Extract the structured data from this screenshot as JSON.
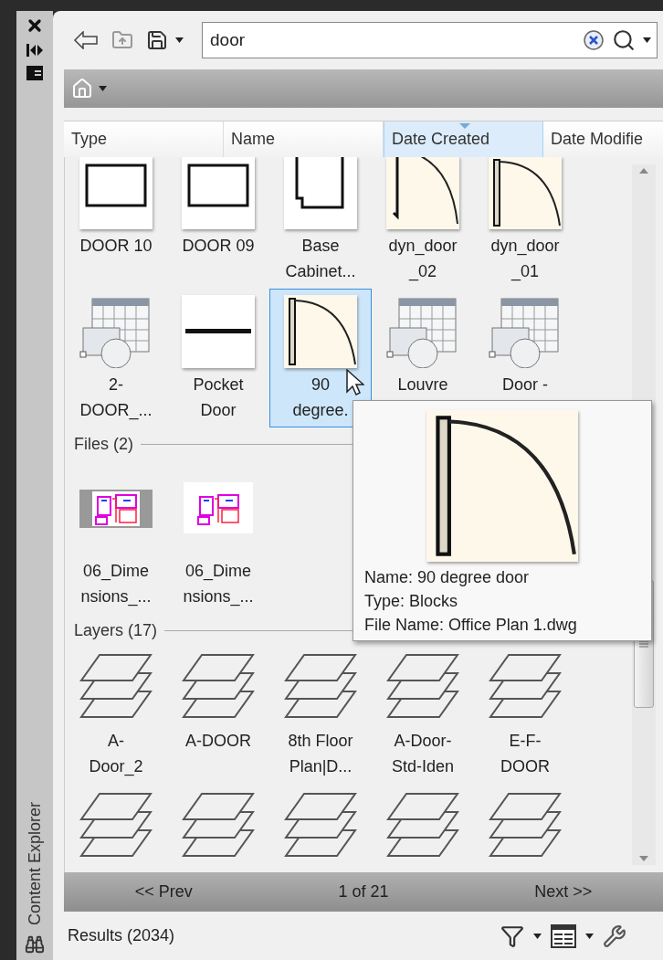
{
  "sidebar": {
    "title": "Content Explorer"
  },
  "search": {
    "value": "door"
  },
  "columns": [
    {
      "label": "Type",
      "selected": false
    },
    {
      "label": "Name",
      "selected": false
    },
    {
      "label": "Date Created",
      "selected": true
    },
    {
      "label": "Date Modifie",
      "selected": false
    }
  ],
  "items": [
    {
      "kind": "rect",
      "label_lines": [
        "DOOR 10"
      ],
      "selected": false
    },
    {
      "kind": "rect",
      "label_lines": [
        "DOOR 09"
      ],
      "selected": false
    },
    {
      "kind": "cabinet",
      "label_lines": [
        "Base",
        "Cabinet..."
      ],
      "selected": false
    },
    {
      "kind": "arc",
      "label_lines": [
        "dyn_door",
        "_02"
      ],
      "selected": false
    },
    {
      "kind": "arc_bar",
      "label_lines": [
        "dyn_door",
        "_01"
      ],
      "selected": false
    },
    {
      "kind": "table",
      "label_lines": [
        "2-",
        "DOOR_..."
      ],
      "selected": false
    },
    {
      "kind": "line",
      "label_lines": [
        "Pocket",
        "Door"
      ],
      "selected": false
    },
    {
      "kind": "arc_bar",
      "label_lines": [
        "90",
        "degree."
      ],
      "selected": true
    },
    {
      "kind": "table",
      "label_lines": [
        "Louvre"
      ],
      "selected": false
    },
    {
      "kind": "table",
      "label_lines": [
        "Door -"
      ],
      "selected": false
    }
  ],
  "sections": [
    {
      "title": "Files (2)",
      "items": [
        {
          "kind": "drawing_gray",
          "label_lines": [
            "06_Dime",
            "nsions_..."
          ],
          "selected": false
        },
        {
          "kind": "drawing",
          "label_lines": [
            "06_Dime",
            "nsions_..."
          ],
          "selected": false
        }
      ]
    },
    {
      "title": "Layers (17)",
      "items": [
        {
          "kind": "layer",
          "label_lines": [
            "A-",
            "Door_2"
          ],
          "selected": false
        },
        {
          "kind": "layer",
          "label_lines": [
            "A-DOOR"
          ],
          "selected": false
        },
        {
          "kind": "layer",
          "label_lines": [
            "8th Floor",
            "Plan|D..."
          ],
          "selected": false
        },
        {
          "kind": "layer",
          "label_lines": [
            "A-Door-",
            "Std-Iden"
          ],
          "selected": false
        },
        {
          "kind": "layer",
          "label_lines": [
            "E-F-",
            "DOOR"
          ],
          "selected": false
        },
        {
          "kind": "layer",
          "selected": false
        },
        {
          "kind": "layer",
          "selected": false
        },
        {
          "kind": "layer",
          "selected": false
        },
        {
          "kind": "layer",
          "selected": false
        },
        {
          "kind": "layer",
          "selected": false
        }
      ]
    }
  ],
  "tooltip": {
    "lines": [
      "Name: 90 degree door",
      "Type: Blocks",
      "File Name: Office Plan 1.dwg"
    ]
  },
  "pager": {
    "prev": "<< Prev",
    "page": "1 of 21",
    "next": "Next >>"
  },
  "status": {
    "results": "Results (2034)"
  }
}
